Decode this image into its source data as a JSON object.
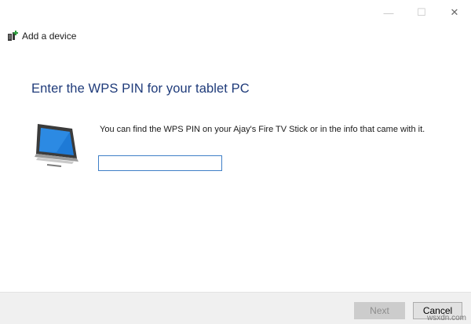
{
  "window": {
    "title": "Add a device",
    "controls": {
      "minimize": "—",
      "maximize": "☐",
      "close": "✕"
    }
  },
  "page": {
    "heading": "Enter the WPS PIN for your tablet PC",
    "info_text": "You can find the WPS PIN on your Ajay's Fire TV Stick or in the info that came with it.",
    "pin_input": {
      "value": "",
      "placeholder": ""
    },
    "device_icon": "tablet-pc-icon"
  },
  "footer": {
    "next_label": "Next",
    "cancel_label": "Cancel",
    "next_enabled": false
  },
  "watermark": "wsxdn.com",
  "colors": {
    "heading": "#1f3b7a",
    "input_border": "#3f7fc7",
    "footer_bg": "#f0f0f0",
    "add_icon_green": "#2e9e3e"
  }
}
